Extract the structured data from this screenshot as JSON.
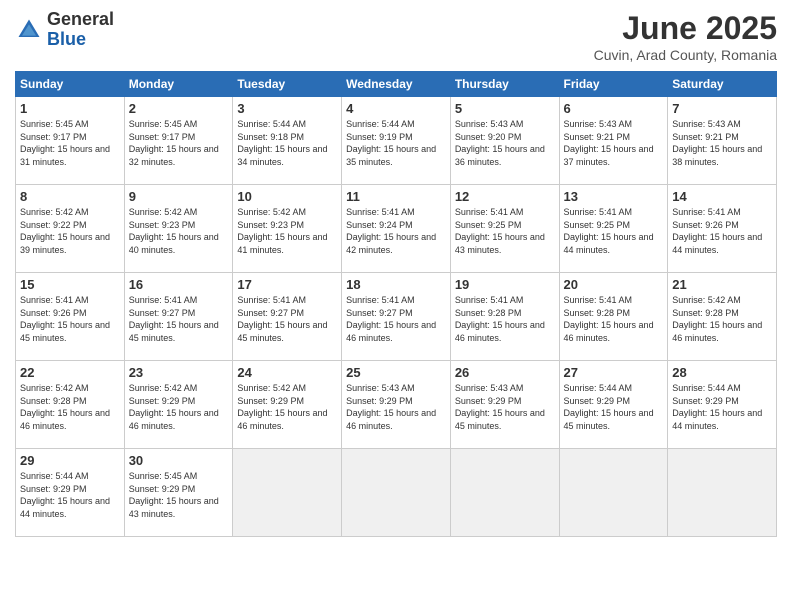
{
  "header": {
    "logo_general": "General",
    "logo_blue": "Blue",
    "month_title": "June 2025",
    "location": "Cuvin, Arad County, Romania"
  },
  "weekdays": [
    "Sunday",
    "Monday",
    "Tuesday",
    "Wednesday",
    "Thursday",
    "Friday",
    "Saturday"
  ],
  "days": [
    {
      "num": "",
      "sunrise": "",
      "sunset": "",
      "daylight": "",
      "empty": true
    },
    {
      "num": "2",
      "sunrise": "Sunrise: 5:45 AM",
      "sunset": "Sunset: 9:17 PM",
      "daylight": "Daylight: 15 hours and 32 minutes."
    },
    {
      "num": "3",
      "sunrise": "Sunrise: 5:44 AM",
      "sunset": "Sunset: 9:18 PM",
      "daylight": "Daylight: 15 hours and 34 minutes."
    },
    {
      "num": "4",
      "sunrise": "Sunrise: 5:44 AM",
      "sunset": "Sunset: 9:19 PM",
      "daylight": "Daylight: 15 hours and 35 minutes."
    },
    {
      "num": "5",
      "sunrise": "Sunrise: 5:43 AM",
      "sunset": "Sunset: 9:20 PM",
      "daylight": "Daylight: 15 hours and 36 minutes."
    },
    {
      "num": "6",
      "sunrise": "Sunrise: 5:43 AM",
      "sunset": "Sunset: 9:21 PM",
      "daylight": "Daylight: 15 hours and 37 minutes."
    },
    {
      "num": "7",
      "sunrise": "Sunrise: 5:43 AM",
      "sunset": "Sunset: 9:21 PM",
      "daylight": "Daylight: 15 hours and 38 minutes."
    },
    {
      "num": "8",
      "sunrise": "Sunrise: 5:42 AM",
      "sunset": "Sunset: 9:22 PM",
      "daylight": "Daylight: 15 hours and 39 minutes."
    },
    {
      "num": "9",
      "sunrise": "Sunrise: 5:42 AM",
      "sunset": "Sunset: 9:23 PM",
      "daylight": "Daylight: 15 hours and 40 minutes."
    },
    {
      "num": "10",
      "sunrise": "Sunrise: 5:42 AM",
      "sunset": "Sunset: 9:23 PM",
      "daylight": "Daylight: 15 hours and 41 minutes."
    },
    {
      "num": "11",
      "sunrise": "Sunrise: 5:41 AM",
      "sunset": "Sunset: 9:24 PM",
      "daylight": "Daylight: 15 hours and 42 minutes."
    },
    {
      "num": "12",
      "sunrise": "Sunrise: 5:41 AM",
      "sunset": "Sunset: 9:25 PM",
      "daylight": "Daylight: 15 hours and 43 minutes."
    },
    {
      "num": "13",
      "sunrise": "Sunrise: 5:41 AM",
      "sunset": "Sunset: 9:25 PM",
      "daylight": "Daylight: 15 hours and 44 minutes."
    },
    {
      "num": "14",
      "sunrise": "Sunrise: 5:41 AM",
      "sunset": "Sunset: 9:26 PM",
      "daylight": "Daylight: 15 hours and 44 minutes."
    },
    {
      "num": "15",
      "sunrise": "Sunrise: 5:41 AM",
      "sunset": "Sunset: 9:26 PM",
      "daylight": "Daylight: 15 hours and 45 minutes."
    },
    {
      "num": "16",
      "sunrise": "Sunrise: 5:41 AM",
      "sunset": "Sunset: 9:27 PM",
      "daylight": "Daylight: 15 hours and 45 minutes."
    },
    {
      "num": "17",
      "sunrise": "Sunrise: 5:41 AM",
      "sunset": "Sunset: 9:27 PM",
      "daylight": "Daylight: 15 hours and 45 minutes."
    },
    {
      "num": "18",
      "sunrise": "Sunrise: 5:41 AM",
      "sunset": "Sunset: 9:27 PM",
      "daylight": "Daylight: 15 hours and 46 minutes."
    },
    {
      "num": "19",
      "sunrise": "Sunrise: 5:41 AM",
      "sunset": "Sunset: 9:28 PM",
      "daylight": "Daylight: 15 hours and 46 minutes."
    },
    {
      "num": "20",
      "sunrise": "Sunrise: 5:41 AM",
      "sunset": "Sunset: 9:28 PM",
      "daylight": "Daylight: 15 hours and 46 minutes."
    },
    {
      "num": "21",
      "sunrise": "Sunrise: 5:42 AM",
      "sunset": "Sunset: 9:28 PM",
      "daylight": "Daylight: 15 hours and 46 minutes."
    },
    {
      "num": "22",
      "sunrise": "Sunrise: 5:42 AM",
      "sunset": "Sunset: 9:28 PM",
      "daylight": "Daylight: 15 hours and 46 minutes."
    },
    {
      "num": "23",
      "sunrise": "Sunrise: 5:42 AM",
      "sunset": "Sunset: 9:29 PM",
      "daylight": "Daylight: 15 hours and 46 minutes."
    },
    {
      "num": "24",
      "sunrise": "Sunrise: 5:42 AM",
      "sunset": "Sunset: 9:29 PM",
      "daylight": "Daylight: 15 hours and 46 minutes."
    },
    {
      "num": "25",
      "sunrise": "Sunrise: 5:43 AM",
      "sunset": "Sunset: 9:29 PM",
      "daylight": "Daylight: 15 hours and 46 minutes."
    },
    {
      "num": "26",
      "sunrise": "Sunrise: 5:43 AM",
      "sunset": "Sunset: 9:29 PM",
      "daylight": "Daylight: 15 hours and 45 minutes."
    },
    {
      "num": "27",
      "sunrise": "Sunrise: 5:44 AM",
      "sunset": "Sunset: 9:29 PM",
      "daylight": "Daylight: 15 hours and 45 minutes."
    },
    {
      "num": "28",
      "sunrise": "Sunrise: 5:44 AM",
      "sunset": "Sunset: 9:29 PM",
      "daylight": "Daylight: 15 hours and 44 minutes."
    },
    {
      "num": "29",
      "sunrise": "Sunrise: 5:44 AM",
      "sunset": "Sunset: 9:29 PM",
      "daylight": "Daylight: 15 hours and 44 minutes."
    },
    {
      "num": "30",
      "sunrise": "Sunrise: 5:45 AM",
      "sunset": "Sunset: 9:29 PM",
      "daylight": "Daylight: 15 hours and 43 minutes."
    },
    {
      "num": "1",
      "sunrise": "Sunrise: 5:45 AM",
      "sunset": "Sunset: 9:17 PM",
      "daylight": "Daylight: 15 hours and 31 minutes.",
      "first": true
    }
  ]
}
